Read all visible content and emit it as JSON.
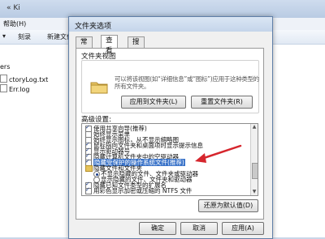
{
  "background": {
    "path_text": "« Ki",
    "menu": [
      "帮助(H)"
    ],
    "toolbar": [
      "▾",
      "刻录",
      "新建文件夹"
    ],
    "files": [
      "ers",
      "ctoryLog.txt",
      "Err.log"
    ]
  },
  "dialog": {
    "title": "文件夹选项",
    "tabs": [
      {
        "label": "常规",
        "active": false
      },
      {
        "label": "查看",
        "active": true
      },
      {
        "label": "搜索",
        "active": false
      }
    ],
    "folder_view": {
      "group_label": "文件夹视图",
      "description": "可以将该视图(如“详细信息”或“图标”)应用于这种类型的所有文件夹。",
      "apply_button": "应用到文件夹(L)",
      "reset_button": "重置文件夹(R)"
    },
    "advanced": {
      "group_label": "高级设置:",
      "items": [
        {
          "label": "使用共享向导(推荐)",
          "kind": "checkbox",
          "checked": true,
          "selected": false
        },
        {
          "label": "始终显示菜单",
          "kind": "checkbox",
          "checked": false,
          "selected": false
        },
        {
          "label": "始终显示图标，从不显示缩略图",
          "kind": "checkbox",
          "checked": false,
          "selected": false
        },
        {
          "label": "鼠标指向文件夹和桌面项时显示提示信息",
          "kind": "checkbox",
          "checked": true,
          "selected": false
        },
        {
          "label": "显示驱动器号",
          "kind": "checkbox",
          "checked": true,
          "selected": false
        },
        {
          "label": "隐藏计算机文件夹中的空驱动器",
          "kind": "checkbox",
          "checked": true,
          "selected": false
        },
        {
          "label": "隐藏受保护的操作系统文件(推荐)",
          "kind": "checkbox",
          "checked": true,
          "selected": true
        },
        {
          "label": "隐藏文件和文件夹",
          "kind": "folder",
          "checked": false,
          "selected": false
        },
        {
          "label": "不显示隐藏的文件、文件夹或驱动器",
          "kind": "radio",
          "checked": true,
          "selected": false
        },
        {
          "label": "显示隐藏的文件、文件夹和驱动器",
          "kind": "radio",
          "checked": false,
          "selected": false
        },
        {
          "label": "隐藏已知文件类型的扩展名",
          "kind": "checkbox",
          "checked": true,
          "selected": false
        },
        {
          "label": "用彩色显示加密或压缩的 NTFS 文件",
          "kind": "checkbox",
          "checked": true,
          "selected": false
        }
      ],
      "restore_button": "还原为默认值(D)"
    },
    "ok_button": "确定",
    "cancel_button": "取消",
    "apply_button": "应用(A)"
  },
  "colors": {
    "arrow": "#d6262d",
    "selection": "#3b74c9"
  }
}
